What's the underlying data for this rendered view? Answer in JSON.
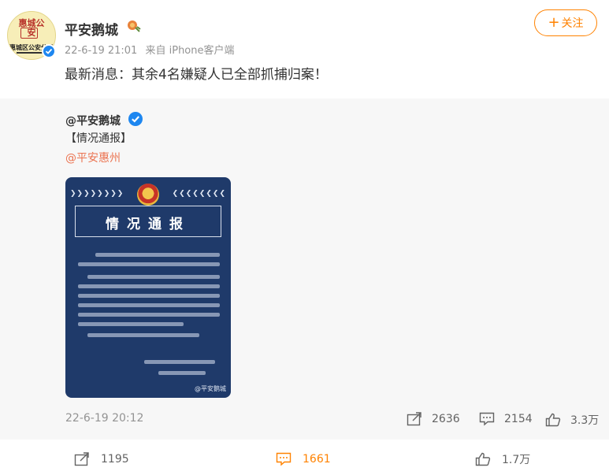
{
  "post": {
    "author": "平安鹅城",
    "avatar_seal_text": "惠城公安",
    "avatar_org_text": "惠城区公安分局",
    "time": "22-6-19 21:01",
    "source": "来自 iPhone客户端",
    "text": "最新消息：其余4名嫌疑人已全部抓捕归案！",
    "follow_label": "关注",
    "follow_plus": "+"
  },
  "repost": {
    "author": "@平安鹅城",
    "line1": "【情况通报】",
    "mention": "@平安惠州",
    "notice_title": "情况通报",
    "notice_watermark": "@平安鹅城",
    "time": "22-6-19 20:12",
    "share_count": "2636",
    "comment_count": "2154",
    "like_count": "3.3万"
  },
  "actions": {
    "share_count": "1195",
    "comment_count": "1661",
    "like_count": "1.7万"
  },
  "colors": {
    "accent": "#ff8200",
    "verified": "#1e87f0",
    "mention": "#eb7350",
    "notice_bg": "#1f3a6a"
  }
}
